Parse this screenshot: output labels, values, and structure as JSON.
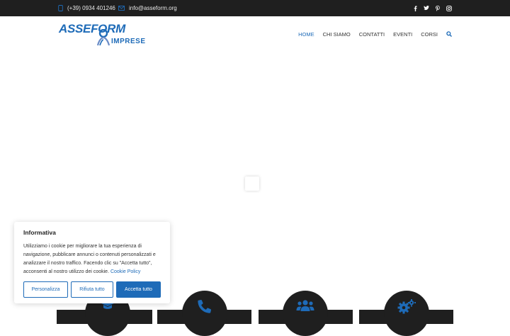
{
  "topbar": {
    "phone": "(+39) 0934 401246",
    "email": "info@asseform.org",
    "socials": [
      "facebook-icon",
      "twitter-icon",
      "pinterest-icon",
      "instagram-icon"
    ]
  },
  "logo": {
    "line1": "ASSEFORM",
    "line2": "IMPRESE"
  },
  "nav": {
    "items": [
      "HOME",
      "CHI SIAMO",
      "CONTATTI",
      "EVENTI",
      "CORSI"
    ],
    "active": "HOME"
  },
  "features": {
    "icons": [
      "graduation-cap-icon",
      "phone-icon",
      "users-icon",
      "cogs-icon"
    ]
  },
  "cookie": {
    "title": "Informativa",
    "text": "Utilizziamo i cookie per migliorare la tua esperienza di navigazione, pubblicare annunci o contenuti personalizzati e analizzare il nostro traffico. Facendo clic su \"Accetta tutto\", acconsenti al nostro utilizzo dei cookie.",
    "link": "Cookie Policy",
    "buttons": {
      "customize": "Personalizza",
      "reject": "Rifiuta tutto",
      "accept": "Accetta tutto"
    }
  },
  "colors": {
    "accent": "#1e6bb8",
    "dark": "#1f1f1f"
  }
}
